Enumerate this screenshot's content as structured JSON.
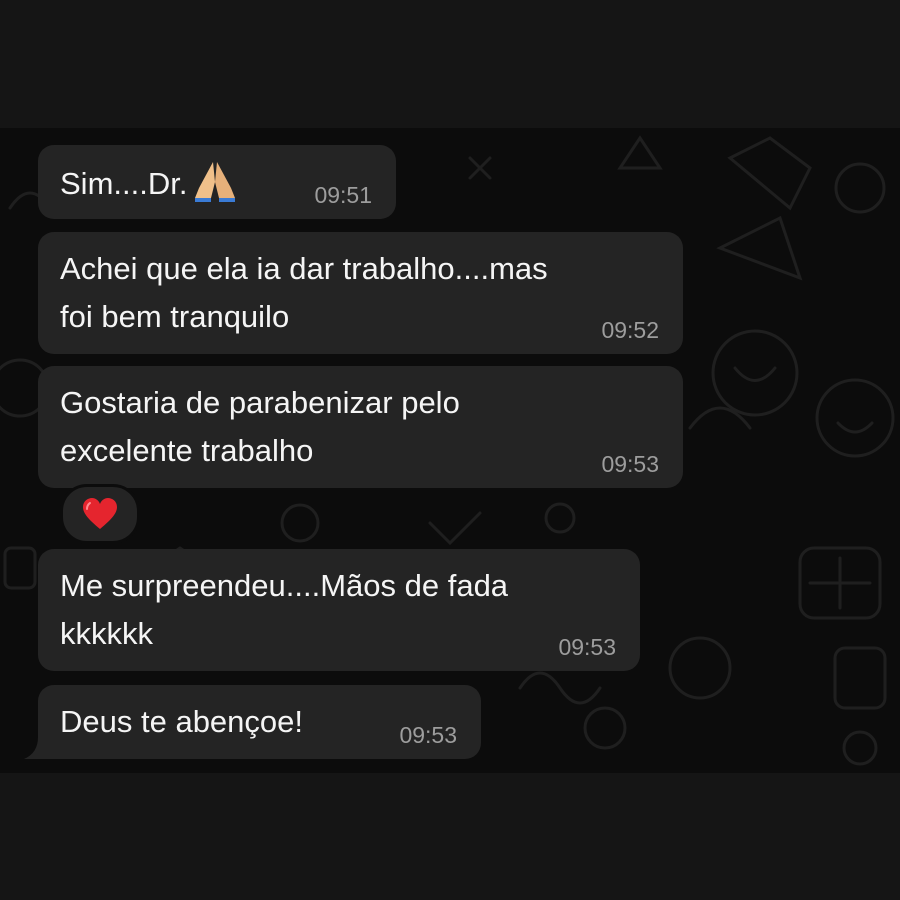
{
  "messages": [
    {
      "text": "Sim....Dr.",
      "emoji": "folded-hands",
      "time": "09:51"
    },
    {
      "text": "Achei que ela ia dar trabalho....mas\nfoi bem tranquilo",
      "time": "09:52"
    },
    {
      "text": "Gostaria de parabenizar pelo\nexcelente trabalho",
      "time": "09:53",
      "reaction": "red-heart"
    },
    {
      "text": "Me surpreendeu....Mãos de fada\nkkkkkk",
      "time": "09:53"
    },
    {
      "text": "Deus te abençoe!",
      "time": "09:53"
    }
  ],
  "colors": {
    "background": "#151515",
    "chat_wallpaper": "#0c0c0c",
    "bubble": "#242424",
    "text": "#f5f5f5",
    "timestamp": "#9d9d9d",
    "heart": "#e5252e"
  }
}
